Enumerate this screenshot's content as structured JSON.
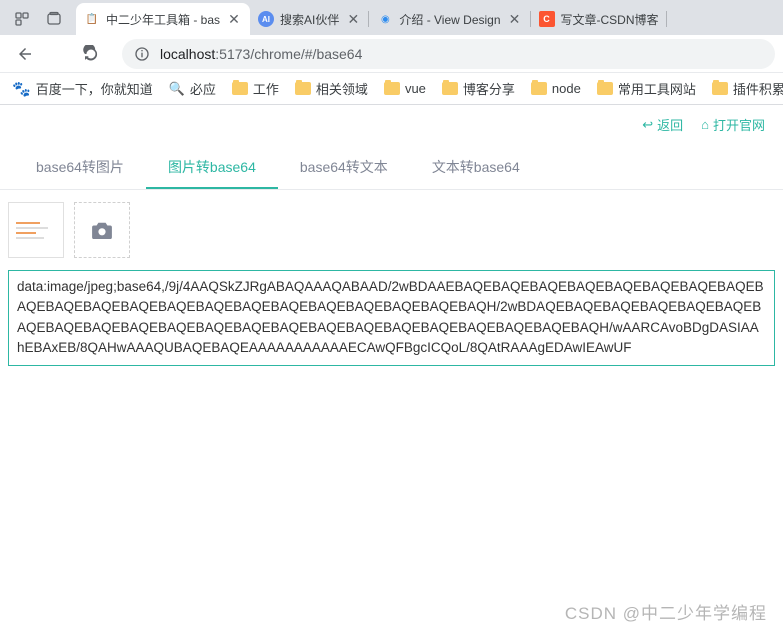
{
  "browser": {
    "tabs": [
      {
        "title": "中二少年工具箱 - bas",
        "active": true,
        "favicon": "toolbox"
      },
      {
        "title": "搜索AI伙伴",
        "active": false,
        "favicon": "ai"
      },
      {
        "title": "介绍 - View Design",
        "active": false,
        "favicon": "view"
      },
      {
        "title": "写文章-CSDN博客",
        "active": false,
        "favicon": "csdn"
      }
    ],
    "url_host": "localhost",
    "url_port": ":5173",
    "url_path": "/chrome/#/base64"
  },
  "bookmarks": [
    {
      "label": "百度一下，你就知道",
      "icon": "baidu"
    },
    {
      "label": "必应",
      "icon": "bing"
    },
    {
      "label": "工作",
      "icon": "folder"
    },
    {
      "label": "相关领域",
      "icon": "folder"
    },
    {
      "label": "vue",
      "icon": "folder"
    },
    {
      "label": "博客分享",
      "icon": "folder"
    },
    {
      "label": "node",
      "icon": "folder"
    },
    {
      "label": "常用工具网站",
      "icon": "folder"
    },
    {
      "label": "插件积累",
      "icon": "folder"
    }
  ],
  "page": {
    "top_links": {
      "back": "返回",
      "official": "打开官网"
    },
    "subtabs": [
      {
        "label": "base64转图片",
        "active": false
      },
      {
        "label": "图片转base64",
        "active": true
      },
      {
        "label": "base64转文本",
        "active": false
      },
      {
        "label": "文本转base64",
        "active": false
      }
    ],
    "textarea_value": "data:image/jpeg;base64,/9j/4AAQSkZJRgABAQAAAQABAAD/2wBDAAEBAQEBAQEBAQEBAQEBAQEBAQEBAQEBAQEBAQEBAQEBAQEBAQEBAQEBAQEBAQEBAQEBAQEBAQEBAQEBAQEBAQH/2wBDAQEBAQEBAQEBAQEBAQEBAQEBAQEBAQEBAQEBAQEBAQEBAQEBAQEBAQEBAQEBAQEBAQEBAQEBAQEBAQEBAQEBAQH/wAARCAvoBDgDASIAAhEBAxEB/8QAHwAAAQUBAQEBAQEAAAAAAAAAAAECAwQFBgcICQoL/8QAtRAAAgEDAwIEAwUF"
  },
  "watermark": "CSDN @中二少年学编程",
  "colors": {
    "accent": "#2db7a3"
  }
}
